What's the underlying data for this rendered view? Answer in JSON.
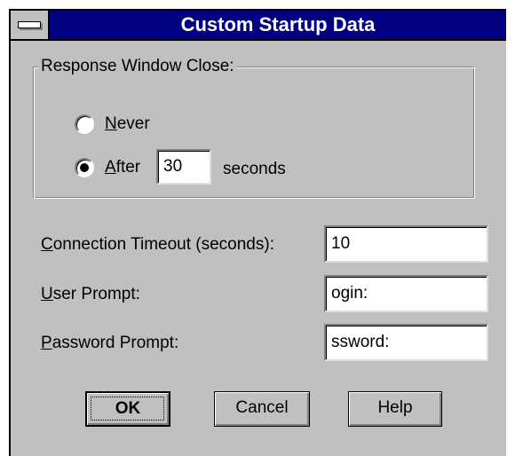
{
  "window": {
    "title": "Custom Startup Data"
  },
  "response_group": {
    "label": "Response Window Close:",
    "never": {
      "mnemonic": "N",
      "rest": "ever",
      "selected": false
    },
    "after": {
      "mnemonic": "A",
      "rest": "fter",
      "selected": true,
      "value": "30",
      "suffix": "seconds"
    }
  },
  "fields": {
    "connection_timeout": {
      "mnemonic": "C",
      "rest": "onnection Timeout (seconds):",
      "value": "10"
    },
    "user_prompt": {
      "mnemonic": "U",
      "rest": "ser Prompt:",
      "value": "ogin:"
    },
    "password_prompt": {
      "mnemonic": "P",
      "rest": "assword Prompt:",
      "value": "ssword:"
    }
  },
  "buttons": {
    "ok": "OK",
    "cancel": "Cancel",
    "help": "Help"
  },
  "icons": {
    "system_menu": "system-menu-icon"
  },
  "colors": {
    "titlebar": "#000080",
    "face": "#c0c0c0",
    "title_text": "#ffffff"
  }
}
